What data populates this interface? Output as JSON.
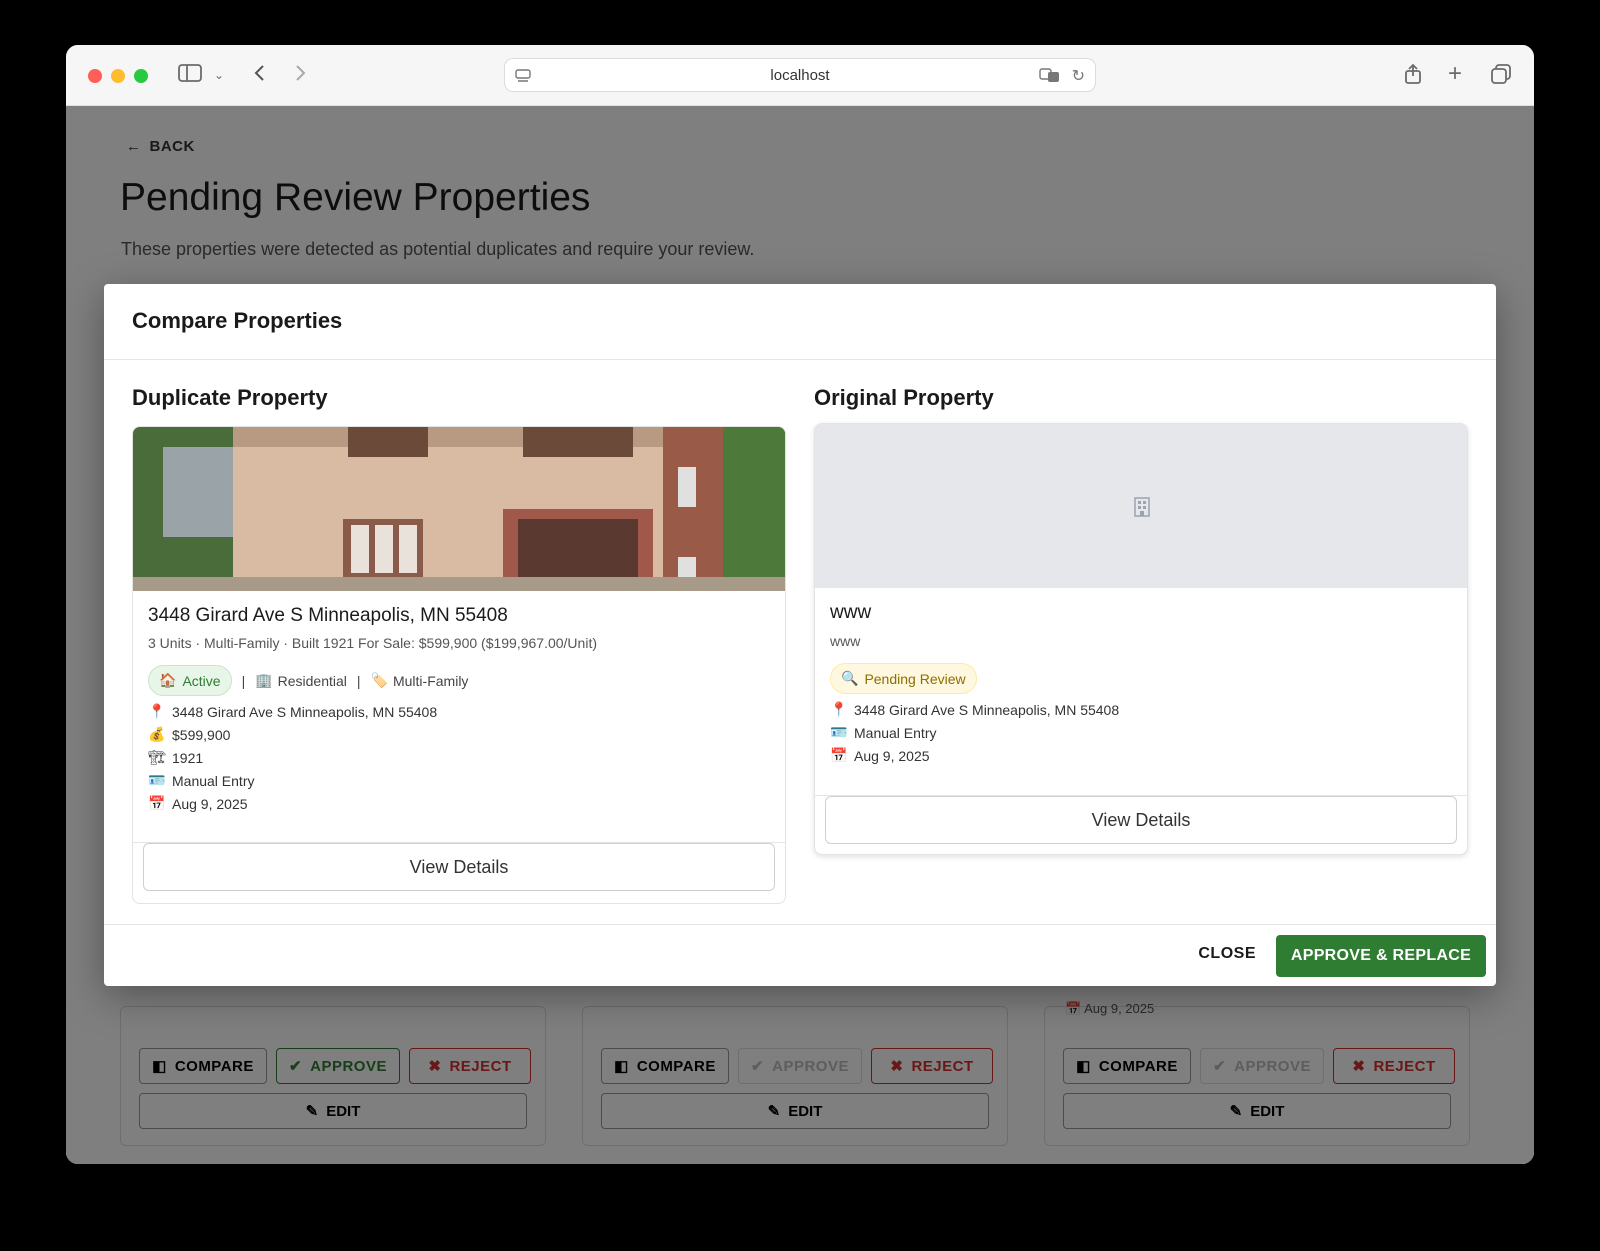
{
  "browser": {
    "url": "localhost"
  },
  "page": {
    "back_label": "BACK",
    "title": "Pending Review Properties",
    "subtitle": "These properties were detected as potential duplicates and require your review."
  },
  "background_cards": [
    {
      "compare": "COMPARE",
      "approve": "APPROVE",
      "reject": "REJECT",
      "edit": "EDIT",
      "approve_enabled": true
    },
    {
      "compare": "COMPARE",
      "approve": "APPROVE",
      "reject": "REJECT",
      "edit": "EDIT",
      "approve_enabled": false
    },
    {
      "compare": "COMPARE",
      "approve": "APPROVE",
      "reject": "REJECT",
      "edit": "EDIT",
      "approve_enabled": false,
      "date_peek": "Aug 9, 2025"
    }
  ],
  "modal": {
    "title": "Compare Properties",
    "close_label": "CLOSE",
    "approve_label": "APPROVE & REPLACE",
    "duplicate": {
      "heading": "Duplicate Property",
      "name": "3448 Girard Ave S Minneapolis, MN 55408",
      "meta": "3 Units · Multi-Family · Built 1921 For Sale: $599,900 ($199,967.00/Unit)",
      "status": "Active",
      "status_icon": "🏠",
      "category": "Residential",
      "category_icon": "🏢",
      "type": "Multi-Family",
      "type_icon": "🏷️",
      "separator": "|",
      "address": "3448 Girard Ave S Minneapolis, MN 55408",
      "price": "$599,900",
      "year": "1921",
      "source": "Manual Entry",
      "date": "Aug 9, 2025",
      "view_label": "View Details"
    },
    "original": {
      "heading": "Original Property",
      "name": "www",
      "meta": "www",
      "status": "Pending Review",
      "status_icon": "🔍",
      "address": "3448 Girard Ave S Minneapolis, MN 55408",
      "source": "Manual Entry",
      "date": "Aug 9, 2025",
      "view_label": "View Details"
    }
  },
  "icons": {
    "pin": "📍",
    "money": "💰",
    "crane": "🏗",
    "id": "🪪",
    "calendar": "📅"
  },
  "colors": {
    "approve_green": "#2e7d32",
    "reject_red": "#d32f2f",
    "active_chip_bg": "#e8f5e9",
    "active_chip_text": "#2e7d32",
    "pending_chip_bg": "#fff8e1",
    "pending_chip_text": "#8d6e00"
  }
}
